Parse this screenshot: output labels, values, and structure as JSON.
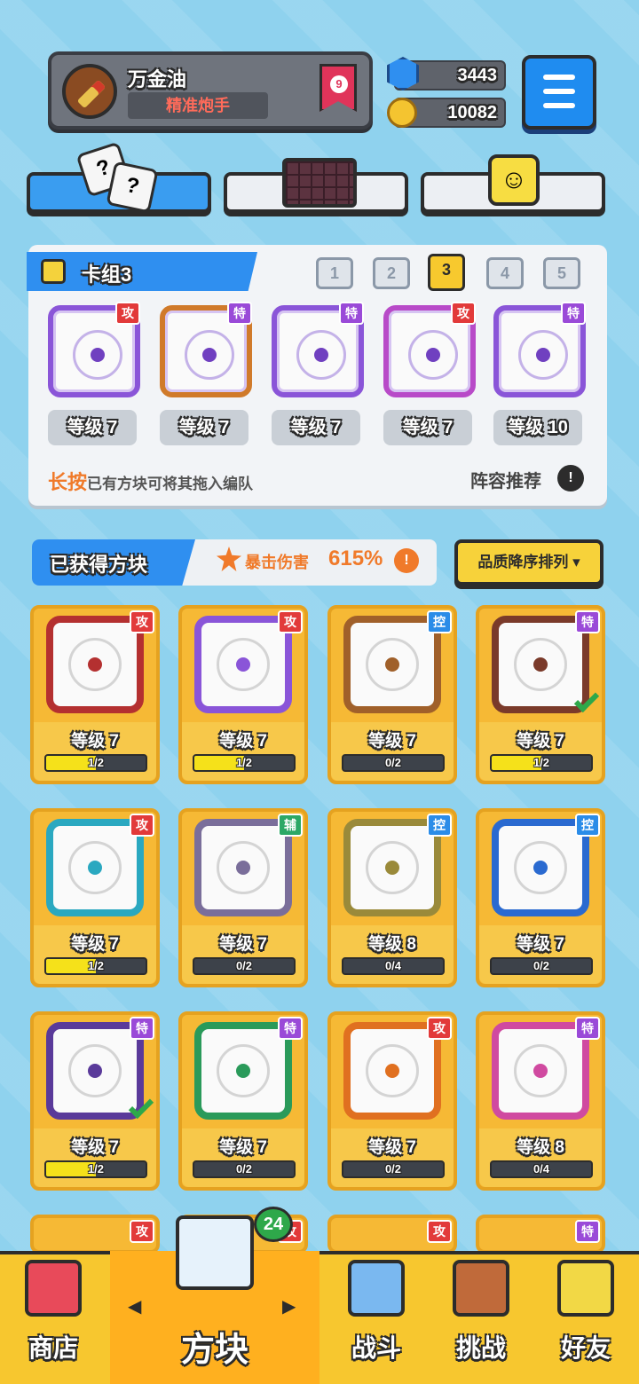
{
  "player": {
    "name": "万金油",
    "title": "精准炮手",
    "rank": "9"
  },
  "currency": {
    "gems": "3443",
    "coins": "10082"
  },
  "deck": {
    "label": "卡组3",
    "slots": [
      "1",
      "2",
      "3",
      "4",
      "5"
    ],
    "active_slot": "3",
    "cards": [
      {
        "tag": "攻",
        "level": "等级 7",
        "frame": "#8a55d8"
      },
      {
        "tag": "特",
        "level": "等级 7",
        "frame": "#d07a2a"
      },
      {
        "tag": "特",
        "level": "等级 7",
        "frame": "#8a55d8"
      },
      {
        "tag": "攻",
        "level": "等级 7",
        "frame": "#b84ac8"
      },
      {
        "tag": "特",
        "level": "等级 10",
        "frame": "#8a55d8"
      }
    ],
    "hint_long": "长按",
    "hint_rest": "已有方块可将其拖入编队",
    "recommend": "阵容推荐"
  },
  "obtained": {
    "label": "已获得方块",
    "crit_label": "暴击伤害",
    "crit_value": "615%",
    "sort": "品质降序排列 ▾",
    "items": [
      {
        "tag": "攻",
        "tag_type": "atk",
        "level": "等级 7",
        "progress": "1/2",
        "fill": 0.5,
        "frame": "#b43030",
        "checked": false
      },
      {
        "tag": "攻",
        "tag_type": "atk",
        "level": "等级 7",
        "progress": "1/2",
        "fill": 0.5,
        "frame": "#8a55d8",
        "checked": false
      },
      {
        "tag": "控",
        "tag_type": "ctl",
        "level": "等级 7",
        "progress": "0/2",
        "fill": 0,
        "frame": "#a0602a",
        "checked": false
      },
      {
        "tag": "特",
        "tag_type": "spc",
        "level": "等级 7",
        "progress": "1/2",
        "fill": 0.5,
        "frame": "#7a3a2a",
        "checked": true
      },
      {
        "tag": "攻",
        "tag_type": "atk",
        "level": "等级 7",
        "progress": "1/2",
        "fill": 0.5,
        "frame": "#2aa8c0",
        "checked": false
      },
      {
        "tag": "辅",
        "tag_type": "sup",
        "level": "等级 7",
        "progress": "0/2",
        "fill": 0,
        "frame": "#7a6e9a",
        "checked": false
      },
      {
        "tag": "控",
        "tag_type": "ctl",
        "level": "等级 8",
        "progress": "0/4",
        "fill": 0,
        "frame": "#9a8a3a",
        "checked": false
      },
      {
        "tag": "控",
        "tag_type": "ctl",
        "level": "等级 7",
        "progress": "0/2",
        "fill": 0,
        "frame": "#2a6ad0",
        "checked": false
      },
      {
        "tag": "特",
        "tag_type": "spc",
        "level": "等级 7",
        "progress": "1/2",
        "fill": 0.5,
        "frame": "#5a3a9a",
        "checked": true
      },
      {
        "tag": "特",
        "tag_type": "spc",
        "level": "等级 7",
        "progress": "0/2",
        "fill": 0,
        "frame": "#2a9a5a",
        "checked": false
      },
      {
        "tag": "攻",
        "tag_type": "atk",
        "level": "等级 7",
        "progress": "0/2",
        "fill": 0,
        "frame": "#e07020",
        "checked": false
      },
      {
        "tag": "特",
        "tag_type": "spc",
        "level": "等级 8",
        "progress": "0/4",
        "fill": 0,
        "frame": "#d04aa0",
        "checked": false
      }
    ],
    "partial_row_tags": [
      {
        "tag": "攻",
        "tag_type": "atk"
      },
      {
        "tag": "攻",
        "tag_type": "atk"
      },
      {
        "tag": "攻",
        "tag_type": "atk"
      },
      {
        "tag": "特",
        "tag_type": "spc"
      }
    ]
  },
  "nav": {
    "shop": "商店",
    "blocks": "方块",
    "battle": "战斗",
    "challenge": "挑战",
    "friends": "好友",
    "badge": "24",
    "arrow_left": "◀",
    "arrow_right": "▶"
  }
}
